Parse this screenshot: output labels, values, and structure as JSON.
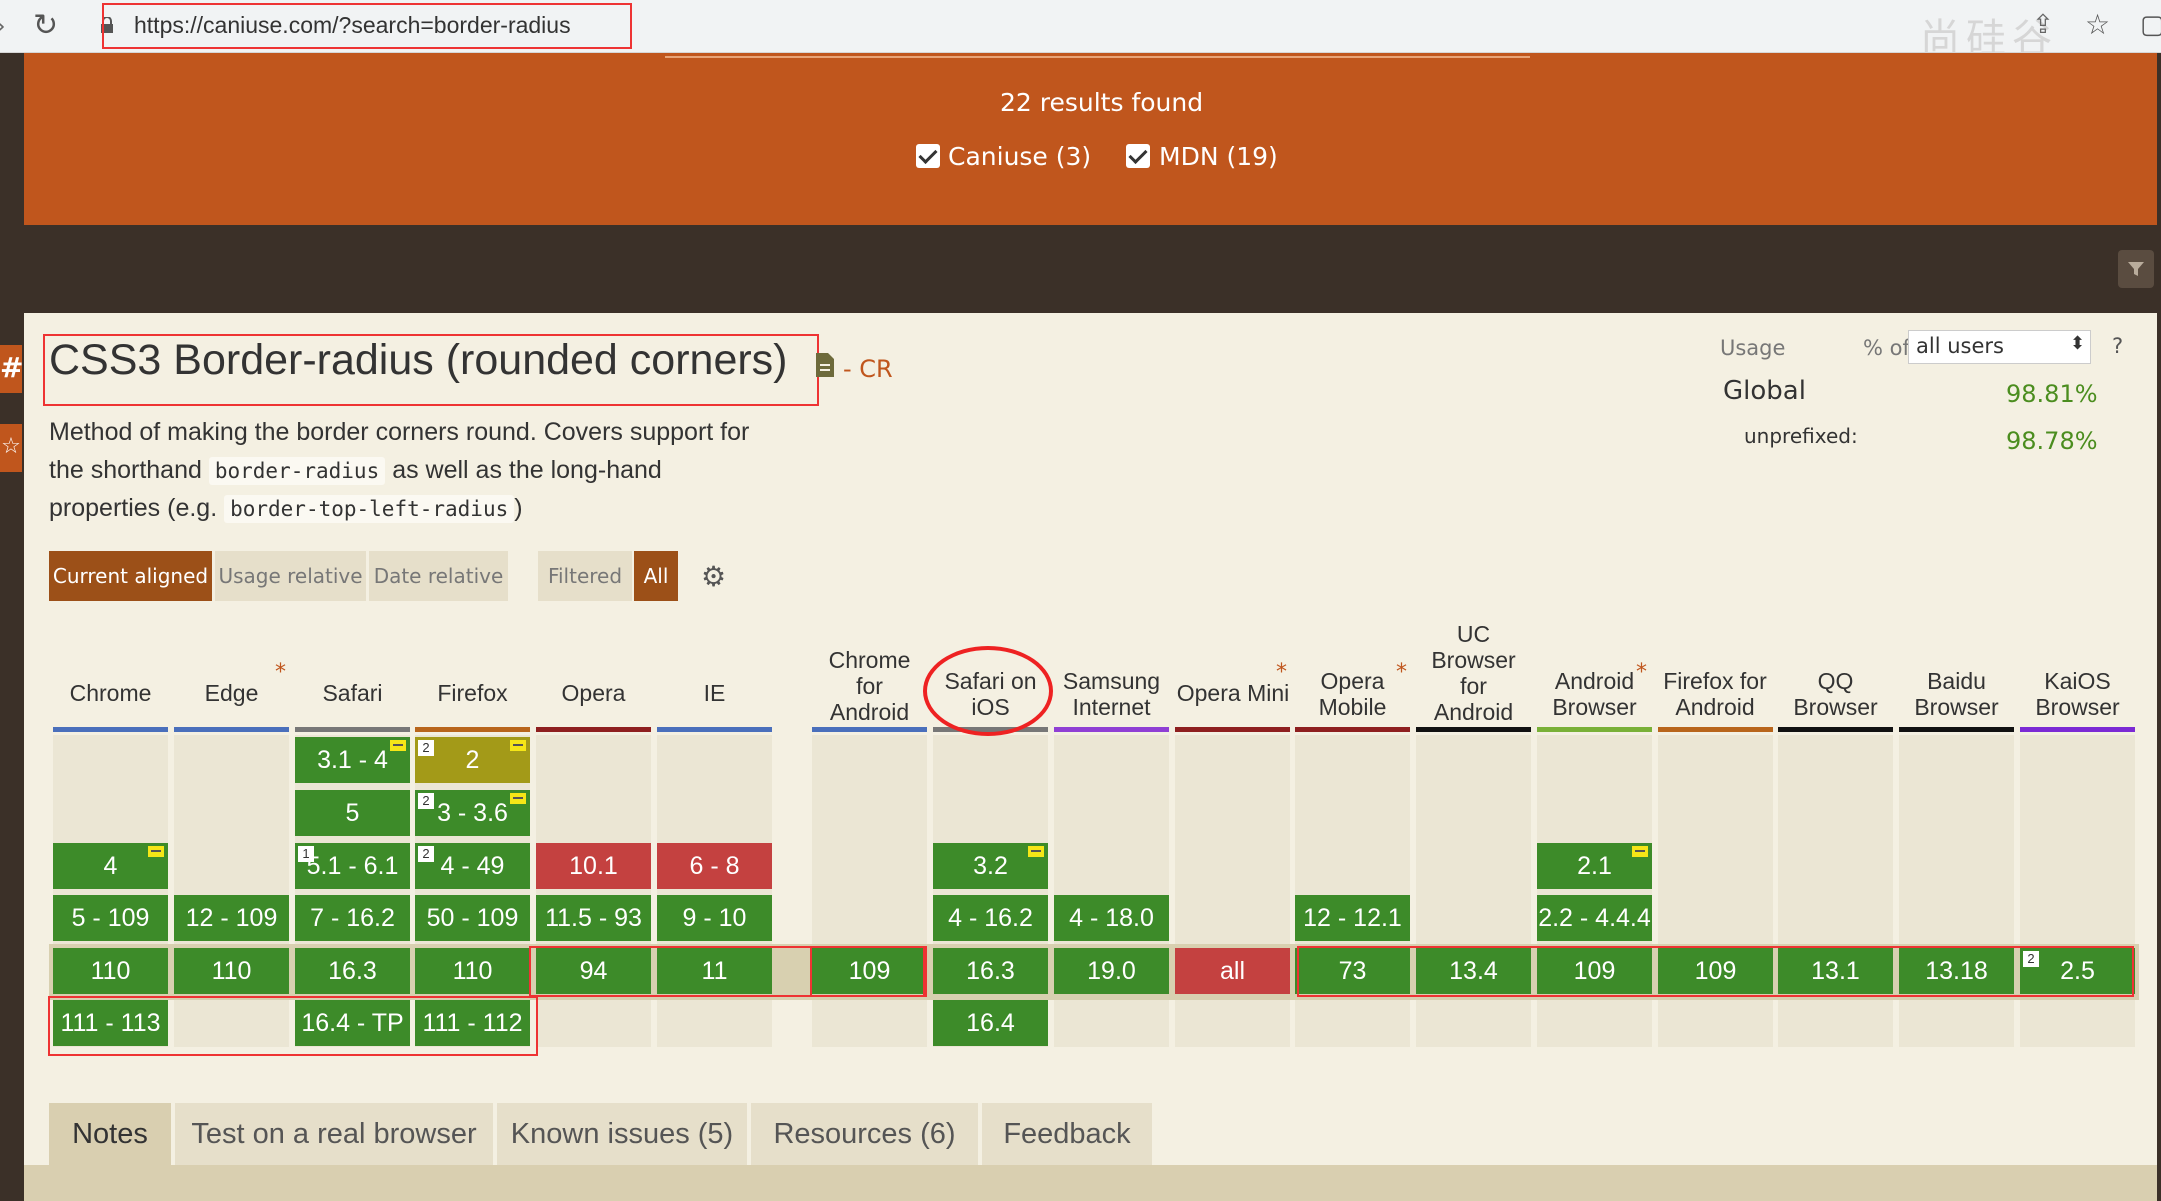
{
  "browser": {
    "url": "https://caniuse.com/?search=border-radius"
  },
  "results": {
    "count_text": "22 results found",
    "filters": [
      {
        "label": "Caniuse (3)",
        "checked": true
      },
      {
        "label": "MDN (19)",
        "checked": true
      }
    ]
  },
  "feature": {
    "title": "CSS3 Border-radius (rounded corners)",
    "spec_status": "- CR",
    "description": {
      "line1": "Method of making the border corners round. Covers support for",
      "line2_before": "the shorthand",
      "line2_code": "border-radius",
      "line2_after": "as well as the long-hand",
      "line3_before": "properties (e.g.",
      "line3_code": "border-top-left-radius",
      "line3_after": ")"
    }
  },
  "usage": {
    "label": "Usage",
    "pct_of": "% of",
    "selected": "all users",
    "help": "?",
    "global_label": "Global",
    "global_value": "98.81%",
    "unprefixed_label": "unprefixed:",
    "unprefixed_value": "98.78%"
  },
  "view_buttons": {
    "current_aligned": "Current aligned",
    "usage_relative": "Usage relative",
    "date_relative": "Date relative",
    "filtered": "Filtered",
    "all": "All"
  },
  "browsers": {
    "chrome": {
      "name": "Chrome",
      "color": "#4a6fbb"
    },
    "edge": {
      "name": "Edge",
      "color": "#4a6fbb"
    },
    "safari": {
      "name": "Safari",
      "color": "#777777"
    },
    "firefox": {
      "name": "Firefox",
      "color": "#b8651b"
    },
    "opera": {
      "name": "Opera",
      "color": "#8e1f1f"
    },
    "ie": {
      "name": "IE",
      "color": "#4a6fbb"
    },
    "chrome_android": {
      "line1": "Chrome",
      "line2": "for",
      "line3": "Android",
      "color": "#4a6fbb"
    },
    "safari_ios": {
      "line1": "Safari on",
      "line2": "iOS",
      "color": "#777777"
    },
    "samsung": {
      "line1": "Samsung",
      "line2": "Internet",
      "color": "#8f3fd4"
    },
    "opera_mini": {
      "name": "Opera Mini",
      "color": "#8e1f1f"
    },
    "opera_mobile": {
      "line1": "Opera",
      "line2": "Mobile",
      "color": "#8e1f1f"
    },
    "uc": {
      "line1": "UC",
      "line2": "Browser",
      "line3": "for",
      "line4": "Android",
      "color": "#111111"
    },
    "android": {
      "line1": "Android",
      "line2": "Browser",
      "color": "#79b037"
    },
    "firefox_android": {
      "line1": "Firefox for",
      "line2": "Android",
      "color": "#b8651b"
    },
    "qq": {
      "line1": "QQ",
      "line2": "Browser",
      "color": "#111111"
    },
    "baidu": {
      "line1": "Baidu",
      "line2": "Browser",
      "color": "#111111"
    },
    "kaios": {
      "line1": "KaiOS",
      "line2": "Browser",
      "color": "#7b2ad4"
    }
  },
  "cells": {
    "safari_r1": "3.1 - 4",
    "safari_r2": "5",
    "safari_r3": "5.1 - 6.1",
    "safari_r4": "7 - 16.2",
    "safari_cur": "16.3",
    "safari_fut": "16.4 - TP",
    "firefox_r1": "2",
    "firefox_r2": "3 - 3.6",
    "firefox_r3": "4 - 49",
    "firefox_r4": "50 - 109",
    "firefox_cur": "110",
    "firefox_fut": "111 - 112",
    "chrome_r3": "4",
    "chrome_r4": "5 - 109",
    "chrome_cur": "110",
    "chrome_fut": "111 - 113",
    "edge_r4": "12 - 109",
    "edge_cur": "110",
    "opera_r3": "10.1",
    "opera_r4": "11.5 - 93",
    "opera_cur": "94",
    "ie_r3": "6 - 8",
    "ie_r4": "9 - 10",
    "ie_cur": "11",
    "chrome_android_cur": "109",
    "safari_ios_r3": "3.2",
    "safari_ios_r4": "4 - 16.2",
    "safari_ios_cur": "16.3",
    "safari_ios_fut": "16.4",
    "samsung_r4": "4 - 18.0",
    "samsung_cur": "19.0",
    "opera_mini_cur": "all",
    "opera_mobile_r4": "12 - 12.1",
    "opera_mobile_cur": "73",
    "uc_cur": "13.4",
    "android_r3": "2.1",
    "android_r4": "2.2 - 4.4.4",
    "android_cur": "109",
    "firefox_android_cur": "109",
    "qq_cur": "13.1",
    "baidu_cur": "13.18",
    "kaios_cur": "2.5",
    "note_1": "1",
    "note_2": "2"
  },
  "tabs": {
    "notes": "Notes",
    "test": "Test on a real browser",
    "known_issues": "Known issues (5)",
    "resources": "Resources (6)",
    "feedback": "Feedback"
  }
}
